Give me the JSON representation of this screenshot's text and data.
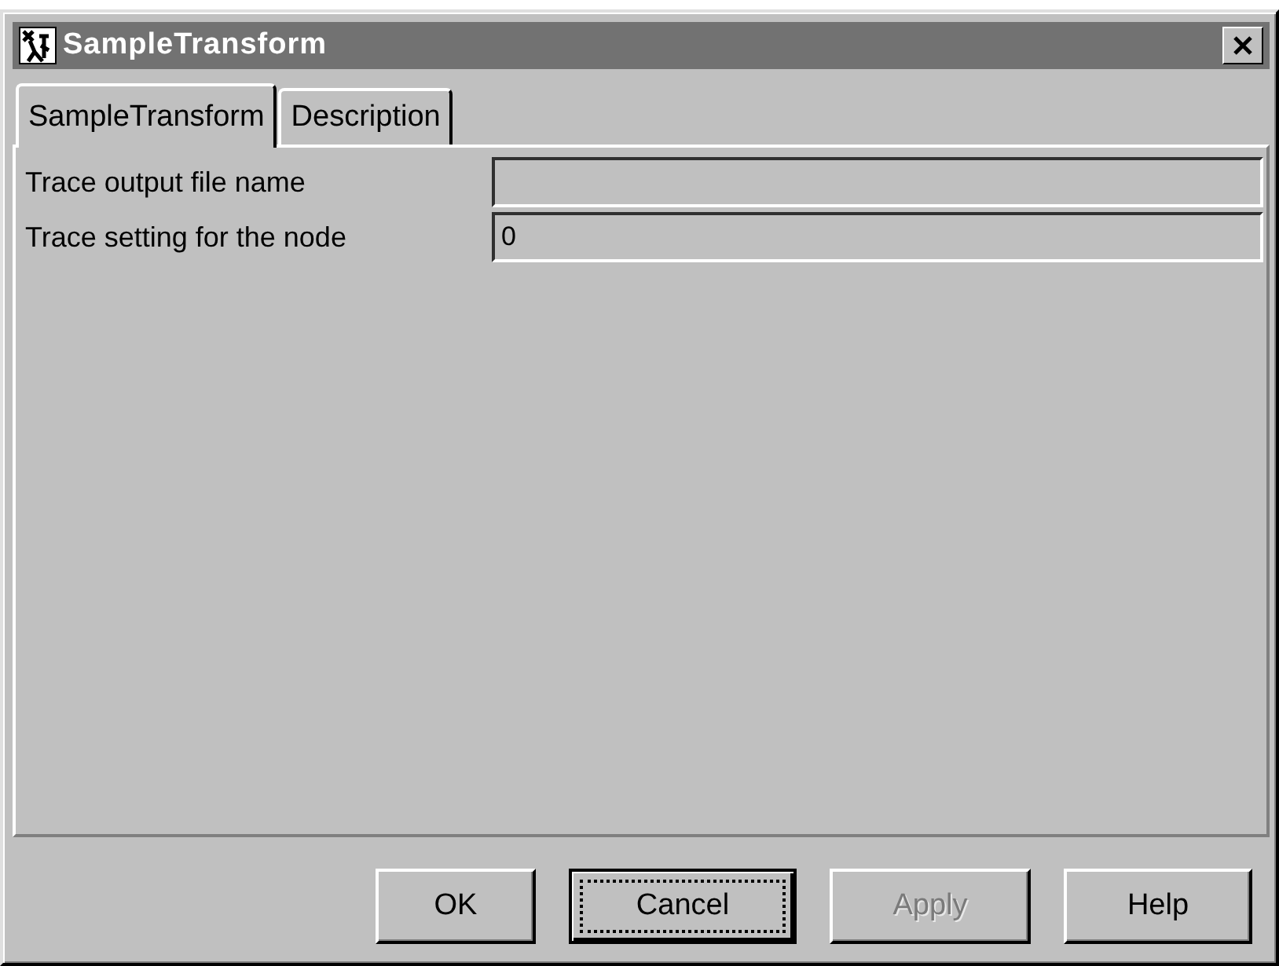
{
  "window": {
    "title": "SampleTransform"
  },
  "tabs": [
    {
      "label": "SampleTransform",
      "selected": true
    },
    {
      "label": "Description",
      "selected": false
    }
  ],
  "fields": [
    {
      "label": "Trace output file name"
    },
    {
      "label": "Trace setting for the node",
      "value": "0"
    }
  ],
  "buttons": [
    {
      "label": "OK",
      "focused": false,
      "disabled": false
    },
    {
      "label": "Cancel",
      "focused": true,
      "disabled": false
    },
    {
      "label": "Apply",
      "focused": false,
      "disabled": true
    },
    {
      "label": "Help",
      "focused": false,
      "disabled": false
    }
  ]
}
